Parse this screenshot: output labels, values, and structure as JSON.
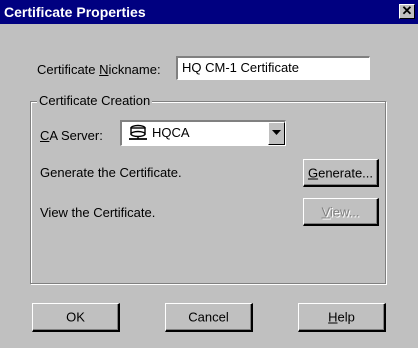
{
  "window": {
    "title": "Certificate Properties",
    "close_glyph": "✕"
  },
  "nickname": {
    "label": "Certificate Nickname:",
    "value": "HQ CM-1 Certificate"
  },
  "creation_group": {
    "legend": "Certificate Creation",
    "ca_server_label": "CA Server:",
    "ca_server_value": "HQCA",
    "ca_server_icon": "server-icon",
    "generate_text": "Generate the Certificate.",
    "generate_button": "Generate...",
    "view_text": "View the Certificate.",
    "view_button": "View..."
  },
  "buttons": {
    "ok": "OK",
    "cancel": "Cancel",
    "help": "Help"
  }
}
